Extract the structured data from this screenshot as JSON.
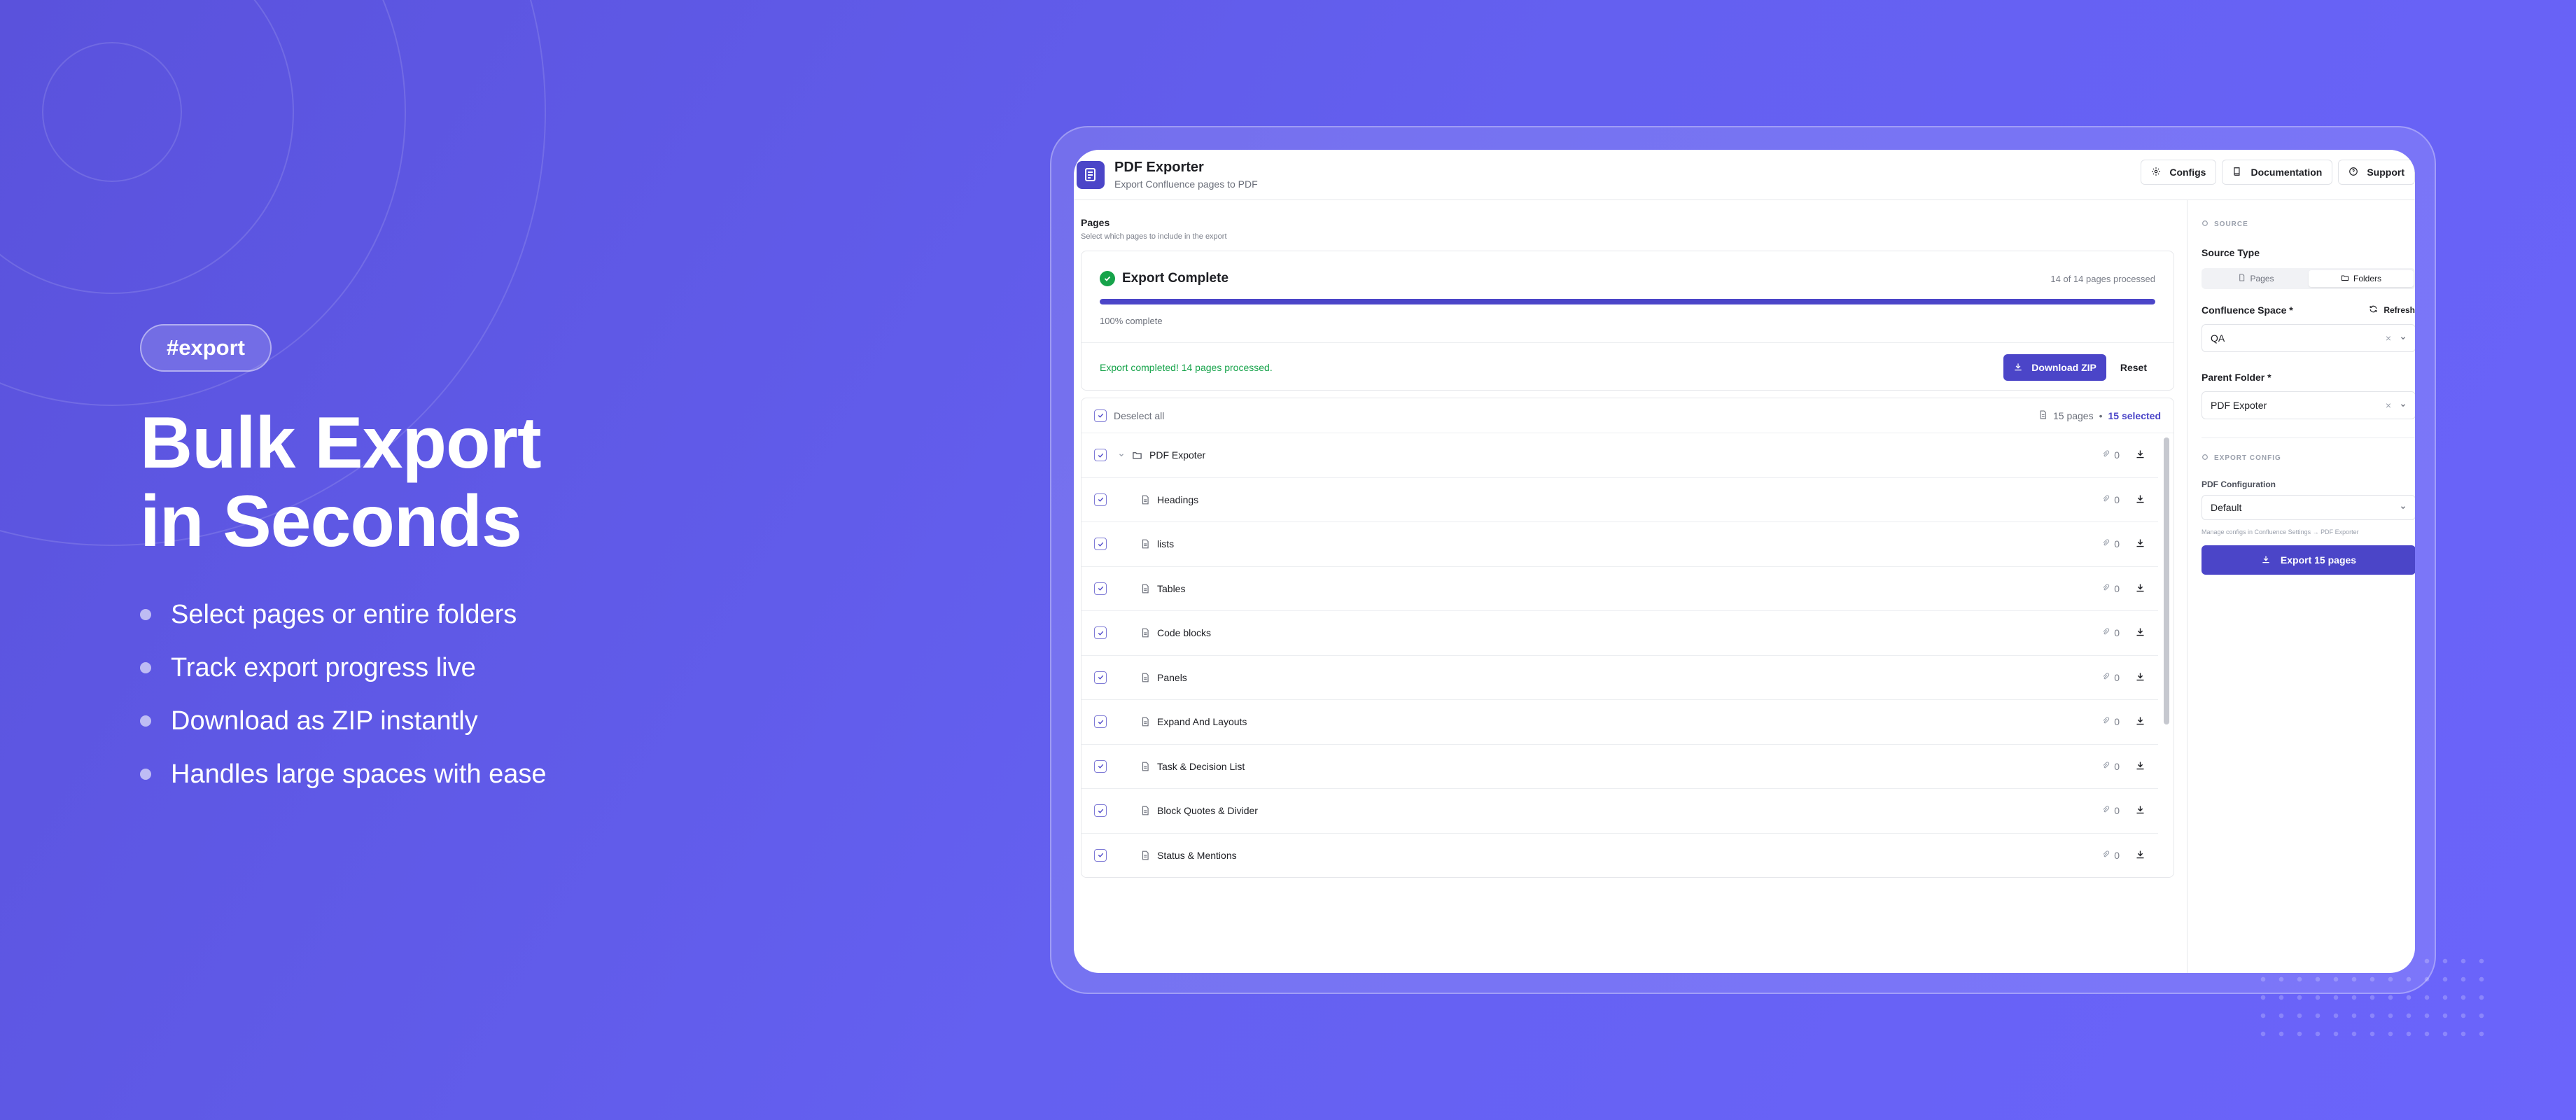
{
  "promo": {
    "tag": "#export",
    "headline_line1": "Bulk Export",
    "headline_line2": "in Seconds",
    "bullets": [
      "Select pages or entire folders",
      "Track export progress live",
      "Download as ZIP instantly",
      "Handles large spaces with ease"
    ]
  },
  "app": {
    "title": "PDF Exporter",
    "subtitle": "Export Confluence pages to PDF",
    "header_buttons": {
      "configs": "Configs",
      "documentation": "Documentation",
      "support": "Support"
    }
  },
  "pages_section": {
    "title": "Pages",
    "subtitle": "Select which pages to include in the export"
  },
  "export_status": {
    "title": "Export Complete",
    "progress_text": "14 of 14 pages processed",
    "progress_fraction": 1.0,
    "percent_text": "100% complete",
    "message": "Export completed! 14 pages processed.",
    "download_label": "Download ZIP",
    "reset_label": "Reset"
  },
  "page_list": {
    "deselect_label": "Deselect all",
    "page_count": "15 pages",
    "separator": "•",
    "selected_count": "15 selected",
    "rows": [
      {
        "name": "PDF Expoter",
        "attachments": "0",
        "type": "folder"
      },
      {
        "name": "Headings",
        "attachments": "0",
        "type": "page"
      },
      {
        "name": "lists",
        "attachments": "0",
        "type": "page"
      },
      {
        "name": "Tables",
        "attachments": "0",
        "type": "page"
      },
      {
        "name": "Code blocks",
        "attachments": "0",
        "type": "page"
      },
      {
        "name": "Panels",
        "attachments": "0",
        "type": "page"
      },
      {
        "name": "Expand And Layouts",
        "attachments": "0",
        "type": "page"
      },
      {
        "name": "Task & Decision List",
        "attachments": "0",
        "type": "page"
      },
      {
        "name": "Block Quotes & Divider",
        "attachments": "0",
        "type": "page"
      },
      {
        "name": "Status & Mentions",
        "attachments": "0",
        "type": "page"
      }
    ]
  },
  "sidebar": {
    "source_kicker": "SOURCE",
    "source_type_label": "Source Type",
    "source_options": [
      "Pages",
      "Folders"
    ],
    "source_selected": "Folders",
    "space_label": "Confluence Space *",
    "refresh_label": "Refresh",
    "space_value": "QA",
    "parent_label": "Parent Folder *",
    "parent_value": "PDF Expoter",
    "config_kicker": "EXPORT CONFIG",
    "pdf_config_label": "PDF Configuration",
    "pdf_config_value": "Default",
    "hint": "Manage configs in Confluence Settings → PDF Exporter",
    "export_button": "Export 15 pages"
  },
  "colors": {
    "accent": "#4b45c8",
    "success": "#16a34a",
    "background_start": "#5a52dc",
    "background_end": "#6b64fb"
  }
}
